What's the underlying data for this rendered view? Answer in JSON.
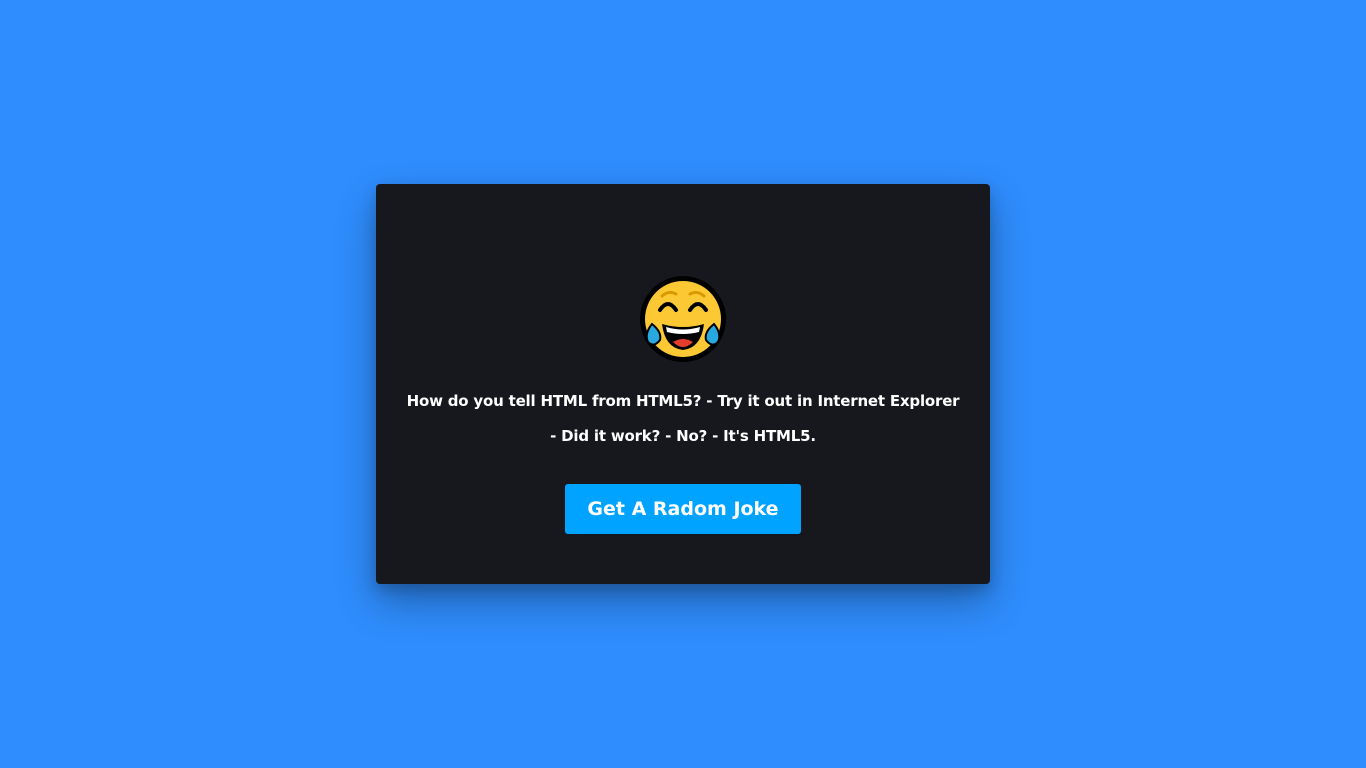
{
  "card": {
    "emoji_icon": "face-with-tears-of-joy-icon",
    "joke_text": "How do you tell HTML from HTML5? - Try it out in Internet Explorer - Did it work? - No? - It's HTML5.",
    "button_label": "Get A Radom Joke"
  },
  "colors": {
    "background": "#2f8dfd",
    "card": "#16181d",
    "button": "#00a3ff",
    "text": "#ffffff"
  }
}
